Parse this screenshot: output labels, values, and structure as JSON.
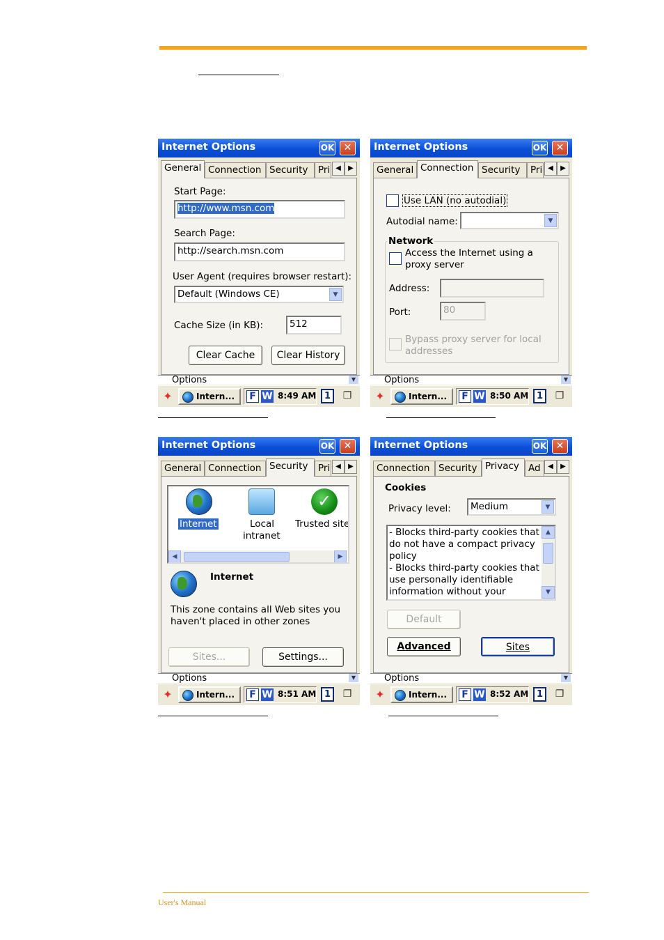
{
  "footer": {
    "text": "User's Manual"
  },
  "screens": [
    {
      "title": "Internet Options",
      "ok": "OK",
      "close": "✕",
      "tabs": [
        "General",
        "Connection",
        "Security",
        "Pri"
      ],
      "options_label": "Options",
      "taskbar": {
        "app": "Intern...",
        "f": "F",
        "w": "W",
        "time": "8:49 AM",
        "desk": "1"
      },
      "general": {
        "start_label": "Start Page:",
        "start_value": "http://www.msn.com",
        "search_label": "Search Page:",
        "search_value": "http://search.msn.com",
        "agent_label": "User Agent (requires browser restart):",
        "agent_value": "Default (Windows CE)",
        "cache_label": "Cache Size (in KB):",
        "cache_value": "512",
        "clear_cache": "Clear Cache",
        "clear_history": "Clear History"
      }
    },
    {
      "title": "Internet Options",
      "ok": "OK",
      "close": "✕",
      "tabs": [
        "General",
        "Connection",
        "Security",
        "Pri"
      ],
      "options_label": "Options",
      "taskbar": {
        "app": "Intern...",
        "f": "F",
        "w": "W",
        "time": "8:50 AM",
        "desk": "1"
      },
      "connection": {
        "use_lan": "Use LAN (no autodial)",
        "autodial_label": "Autodial name:",
        "autodial_value": "",
        "network_heading": "Network",
        "proxy_line1": "Access the Internet using a",
        "proxy_line2": "proxy server",
        "address_label": "Address:",
        "address_value": "",
        "port_label": "Port:",
        "port_value": "80",
        "bypass_line1": "Bypass proxy server for local",
        "bypass_line2": "addresses"
      }
    },
    {
      "title": "Internet Options",
      "ok": "OK",
      "close": "✕",
      "tabs": [
        "General",
        "Connection",
        "Security",
        "Pri"
      ],
      "options_label": "Options",
      "taskbar": {
        "app": "Intern...",
        "f": "F",
        "w": "W",
        "time": "8:51 AM",
        "desk": "1"
      },
      "security": {
        "zones": [
          {
            "label": "Internet",
            "icon": "globe-icon"
          },
          {
            "label1": "Local",
            "label2": "intranet",
            "icon": "local-intranet-icon"
          },
          {
            "label": "Trusted site",
            "icon": "check-icon"
          }
        ],
        "zone_title": "Internet",
        "zone_desc1": "This zone contains all Web sites you",
        "zone_desc2": "haven't placed in other zones",
        "sites_btn": "Sites...",
        "settings_btn": "Settings..."
      }
    },
    {
      "title": "Internet Options",
      "ok": "OK",
      "close": "✕",
      "tabs": [
        "Connection",
        "Security",
        "Privacy",
        "Ad"
      ],
      "options_label": "Options",
      "taskbar": {
        "app": "Intern...",
        "f": "F",
        "w": "W",
        "time": "8:52 AM",
        "desk": "1"
      },
      "privacy": {
        "cookies_heading": "Cookies",
        "level_label": "Privacy level:",
        "level_value": "Medium",
        "desc_lines": [
          "- Blocks third-party cookies that",
          "do not have a compact privacy",
          "policy",
          "- Blocks third-party cookies that",
          "use personally identifiable",
          "information without your"
        ],
        "default_btn": "Default",
        "advanced_btn": "Advanced",
        "sites_btn": "Sites"
      }
    }
  ]
}
